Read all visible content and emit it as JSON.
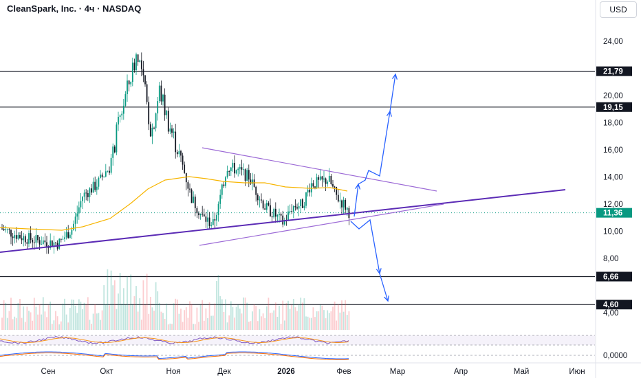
{
  "header": {
    "title": "CleanSpark, Inc. · 4ч · NASDAQ",
    "currency_button": "USD"
  },
  "colors": {
    "up": "#089981",
    "down": "#131722",
    "ma": "#f7b500",
    "channel": "#9c6ad6",
    "support": "#5b2bb5",
    "arrows": "#2962ff",
    "last_price": "#089981",
    "level_line": "#131722"
  },
  "chart_data": {
    "type": "candlestick",
    "title": "CleanSpark, Inc. · 4ч · NASDAQ",
    "y_axis": {
      "min": 2.6,
      "max": 25.9,
      "ticks": [
        "24,00",
        "20,00",
        "18,00",
        "16,00",
        "14,00",
        "12,00",
        "10,00",
        "8,00",
        "4,00"
      ],
      "side": "right"
    },
    "x_axis": {
      "ticks": [
        "Сен",
        "Окт",
        "Ноя",
        "Дек",
        "2026",
        "Фев",
        "Мар",
        "Апр",
        "Май",
        "Июн"
      ]
    },
    "price_path": [
      [
        "Сен start",
        10.2
      ],
      [
        "Sep mid",
        9.5
      ],
      [
        "Sep late",
        9.2
      ],
      [
        "Oct start",
        12.5
      ],
      [
        "Oct mid",
        15.5
      ],
      [
        "Oct peak",
        23.5
      ],
      [
        "Oct late",
        20.5
      ],
      [
        "Ноя start",
        17.5
      ],
      [
        "Nov mid",
        13.8
      ],
      [
        "Nov late",
        10.4
      ],
      [
        "Дек start",
        14.8
      ],
      [
        "Dec mid",
        14.5
      ],
      [
        "Dec late",
        11.5
      ],
      [
        "Jan start",
        10.8
      ],
      [
        "Jan mid",
        13.2
      ],
      [
        "Jan late",
        14.2
      ],
      [
        "Фев start",
        11.36
      ]
    ],
    "moving_average": [
      [
        10.8,
        "Sep"
      ],
      [
        10.2,
        "Oct start"
      ],
      [
        12.0,
        "Oct end"
      ],
      [
        14.0,
        "Nov"
      ],
      [
        13.4,
        "Dec"
      ],
      [
        13.2,
        "Jan"
      ],
      [
        13.2,
        "Feb"
      ]
    ],
    "horizontal_levels": [
      {
        "value": 21.79,
        "label": "21,79"
      },
      {
        "value": 19.15,
        "label": "19,15"
      },
      {
        "value": 6.66,
        "label": "6,66"
      },
      {
        "value": 4.6,
        "label": "4,60"
      }
    ],
    "last_price": {
      "value": 11.36,
      "label": "11,36"
    },
    "trendlines": [
      "support from Sep 8.5 rising to 13.0",
      "triangle upper 16.2 falling to 13.0",
      "triangle lower 9.0 rising to 12.0"
    ],
    "scenario_arrows": [
      "up to 21.79",
      "down to 4.60"
    ],
    "indicator_1": {
      "type": "oscillator",
      "band": "shaded"
    },
    "indicator_2": {
      "type": "macd",
      "zero_label": "0,0000"
    }
  }
}
